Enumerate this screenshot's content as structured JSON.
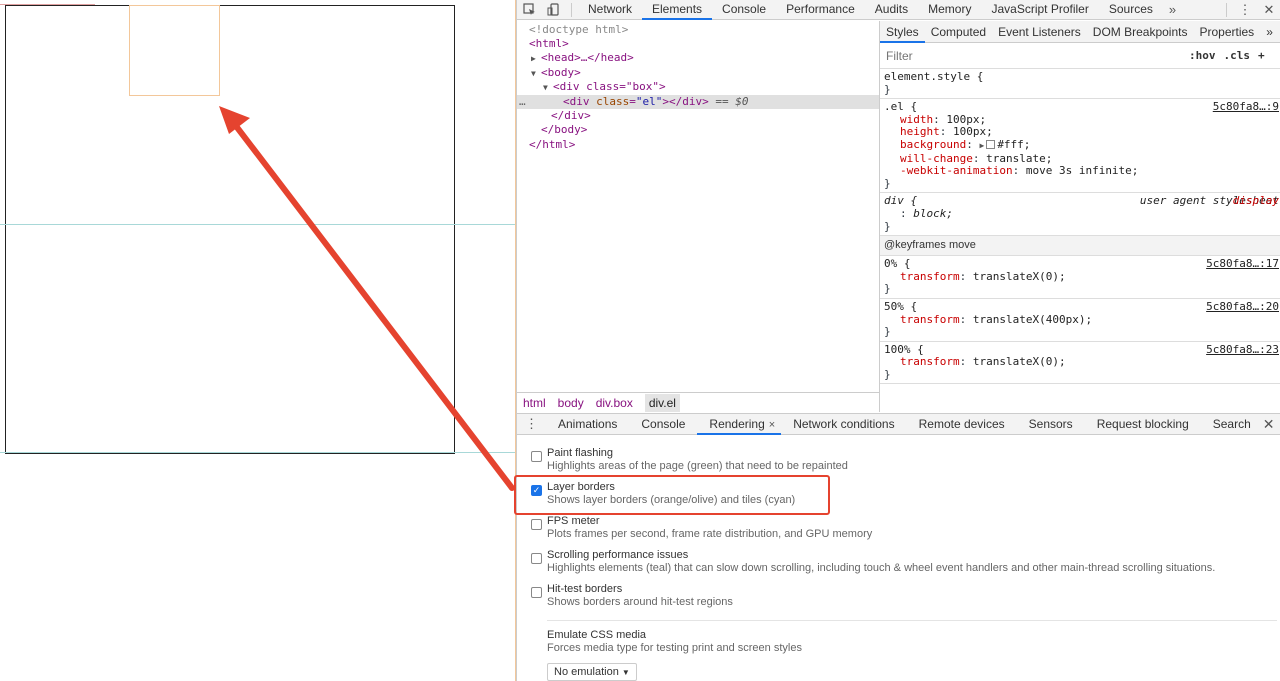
{
  "toolbar": {
    "tabs": [
      "Network",
      "Elements",
      "Console",
      "Performance",
      "Audits",
      "Memory",
      "JavaScript Profiler",
      "Sources"
    ],
    "more": "»",
    "menu": "⋮",
    "close": "✕"
  },
  "dom": {
    "doctype": "<!doctype html>",
    "html_open": "<html>",
    "head": "<head>…</head>",
    "body_open": "<body>",
    "div_box": "<div class=\"box\">",
    "div_el_tag": "div",
    "div_el_attr": "class",
    "div_el_val": "\"el\"",
    "eq0": "== $0",
    "div_close": "</div>",
    "body_close": "</body>",
    "html_close": "</html>",
    "dots": "…"
  },
  "breadcrumb": [
    "html",
    "body",
    "div.box",
    "div.el"
  ],
  "styles": {
    "tabs": [
      "Styles",
      "Computed",
      "Event Listeners",
      "DOM Breakpoints",
      "Properties"
    ],
    "more": "»",
    "filter_placeholder": "Filter",
    "hov": ":hov",
    "cls": ".cls",
    "plus": "+",
    "element_style": "element.style {",
    "close_brace": "}",
    "el_rule": {
      "selector": ".el {",
      "source": "5c80fa8…:9",
      "decls": [
        {
          "name": "width",
          "value": "100px;"
        },
        {
          "name": "height",
          "value": "100px;"
        },
        {
          "name": "background",
          "value": "#fff;"
        },
        {
          "name": "will-change",
          "value": "translate;"
        },
        {
          "name": "-webkit-animation",
          "value": "move 3s infinite;"
        }
      ]
    },
    "div_rule": {
      "selector": "div {",
      "source": "user agent stylesheet",
      "decl_name": "display",
      "decl_value": "block;"
    },
    "keyframes_header": "@keyframes move",
    "keyframes": [
      {
        "sel": "0% {",
        "source": "5c80fa8…:17",
        "name": "transform",
        "value": "translateX(0);"
      },
      {
        "sel": "50% {",
        "source": "5c80fa8…:20",
        "name": "transform",
        "value": "translateX(400px);"
      },
      {
        "sel": "100% {",
        "source": "5c80fa8…:23",
        "name": "transform",
        "value": "translateX(0);"
      }
    ]
  },
  "drawer": {
    "tabs": [
      "Animations",
      "Console",
      "Rendering",
      "Network conditions",
      "Remote devices",
      "Sensors",
      "Request blocking",
      "Search"
    ],
    "tab_close": "×",
    "close": "✕"
  },
  "rendering": {
    "options": [
      {
        "title": "Paint flashing",
        "desc": "Highlights areas of the page (green) that need to be repainted",
        "checked": false
      },
      {
        "title": "Layer borders",
        "desc": "Shows layer borders (orange/olive) and tiles (cyan)",
        "checked": true
      },
      {
        "title": "FPS meter",
        "desc": "Plots frames per second, frame rate distribution, and GPU memory",
        "checked": false
      },
      {
        "title": "Scrolling performance issues",
        "desc": "Highlights elements (teal) that can slow down scrolling, including touch & wheel event handlers and other main-thread scrolling situations.",
        "checked": false
      },
      {
        "title": "Hit-test borders",
        "desc": "Shows borders around hit-test regions",
        "checked": false
      }
    ],
    "emulate_title": "Emulate CSS media",
    "emulate_desc": "Forces media type for testing print and screen styles",
    "emulate_value": "No emulation"
  },
  "colors": {
    "accent": "#1a73e8",
    "annotation": "#e5432f"
  }
}
